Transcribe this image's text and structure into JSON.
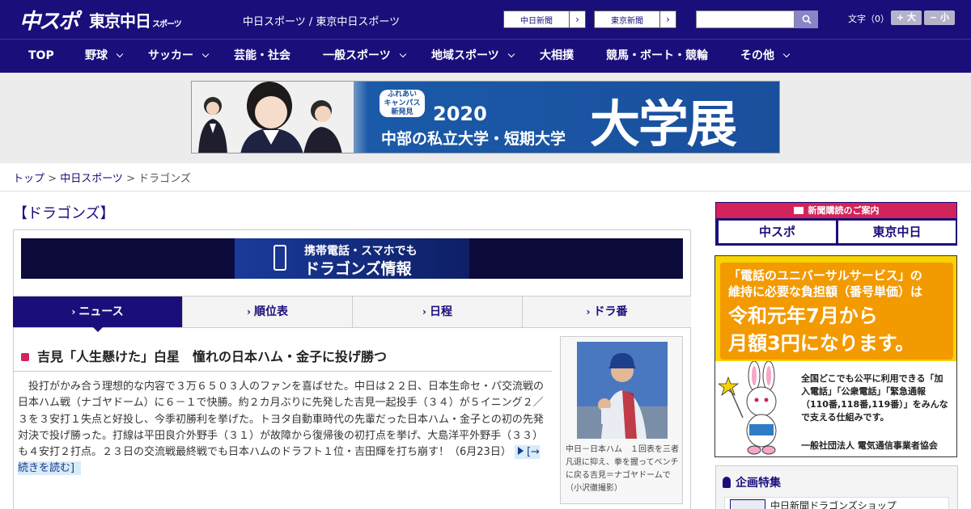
{
  "header": {
    "logo_chuspo": "中スポ",
    "logo_tokyo": "東京中日",
    "logo_tokyo_small": "スポーツ",
    "title": "中日スポーツ / 東京中日スポーツ",
    "btn_chunichi": "中日新聞",
    "btn_tokyo": "東京新聞",
    "font_size_label": "文字（0）",
    "font_plus": "+ 大",
    "font_minus": "− 小",
    "search_placeholder": ""
  },
  "nav": {
    "items": [
      {
        "label": "TOP",
        "dropdown": false
      },
      {
        "label": "野球",
        "dropdown": true
      },
      {
        "label": "サッカー",
        "dropdown": true
      },
      {
        "label": "芸能・社会",
        "dropdown": false
      },
      {
        "label": "一般スポーツ",
        "dropdown": true
      },
      {
        "label": "地域スポーツ",
        "dropdown": true
      },
      {
        "label": "大相撲",
        "dropdown": false
      },
      {
        "label": "競馬・ボート・競輪",
        "dropdown": false
      },
      {
        "label": "その他",
        "dropdown": true
      }
    ]
  },
  "banner": {
    "badge_line1": "ふれあい",
    "badge_line2": "キャンパス",
    "badge_line3": "新発見",
    "year": "2020",
    "subtitle": "中部の私立大学・短期大学",
    "big": "大学展"
  },
  "breadcrumb": {
    "top": "トップ",
    "sep": " > ",
    "section": "中日スポーツ",
    "current": "ドラゴンズ"
  },
  "page": {
    "heading": "【ドラゴンズ】",
    "mobile_banner_line1": "携帯電話・スマホでも",
    "mobile_banner_line2": "ドラゴンズ情報"
  },
  "tabs": [
    {
      "label": "ニュース",
      "active": true
    },
    {
      "label": "順位表",
      "active": false
    },
    {
      "label": "日程",
      "active": false
    },
    {
      "label": "ドラ番",
      "active": false
    }
  ],
  "article": {
    "title": "吉見「人生懸けた」白星　憧れの日本ハム・金子に投げ勝つ",
    "body": "　投打がかみ合う理想的な内容で３万６５０３人のファンを喜ばせた。中日は２２日、日本生命セ・パ交流戦の日本ハム戦（ナゴヤドーム）に６－１で快勝。約２カ月ぶりに先発した吉見一起投手（３４）が５イニング２／３を３安打１失点と好投し、今季初勝利を挙げた。トヨタ自動車時代の先輩だった日本ハム・金子との初の先発対決で投げ勝った。打線は平田良介外野手（３１）が故障から復帰後の初打点を挙げ、大島洋平外野手（３３）も４安打２打点。２３日の交流戦最終戦でも日本ハムのドラフト１位・吉田輝を打ち崩す！（6月23日）",
    "read_more": "[→続きを読む]",
    "photo_caption": "中日－日本ハム　１回表を三者凡退に抑え、拳を握ってベンチに戻る吉見＝ナゴヤドームで（小沢徹撮影）"
  },
  "sidebar": {
    "subscribe_header": "新聞購読のご案内",
    "subscribe_chuspo": "中スポ",
    "subscribe_tokyo": "東京中日",
    "universal_line1": "「電話のユニバーサルサービス」の",
    "universal_line2": "維持に必要な負担額（番号単価）は",
    "universal_line3": "令和元年7月から",
    "universal_line4": "月額3円になります。",
    "universal_body": "全国どこでも公平に利用できる「加入電話」「公衆電話」「緊急通報（110番,118番,119番）」をみんなで支える仕組みです。",
    "universal_org": "一般社団法人 電気通信事業者協会",
    "feature_heading": "企画特集",
    "feature_item": "中日新聞ドラゴンズショップ"
  },
  "colors": {
    "brand_navy": "#1a0f7a",
    "accent_pink": "#d2235a",
    "universal_orange": "#f39a00",
    "universal_yellow": "#f7d300"
  }
}
